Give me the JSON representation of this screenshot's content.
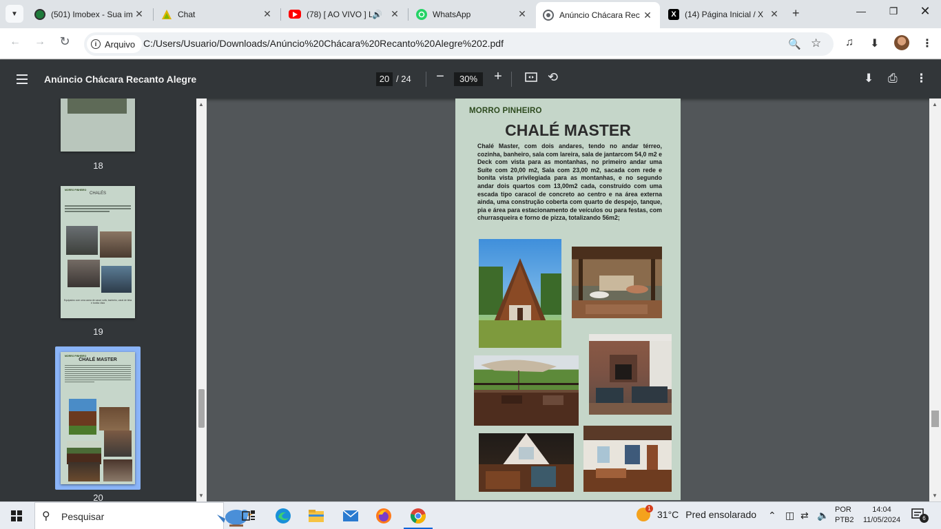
{
  "tabs": [
    {
      "title": "(501) Imobex - Sua im",
      "icon": "imobex-icon"
    },
    {
      "title": "Chat",
      "icon": "chat-icon"
    },
    {
      "title": "(78) [ AO VIVO ] L",
      "icon": "youtube-icon"
    },
    {
      "title": "WhatsApp",
      "icon": "whatsapp-icon"
    },
    {
      "title": "Anúncio Chácara Rec",
      "icon": "globe-icon"
    },
    {
      "title": "(14) Página Inicial / X",
      "icon": "x-icon"
    }
  ],
  "address": {
    "chip_label": "Arquivo",
    "url": "C:/Users/Usuario/Downloads/Anúncio%20Chácara%20Recanto%20Alegre%202.pdf"
  },
  "pdf": {
    "title": "Anúncio Chácara Recanto Alegre",
    "current_page": "20",
    "total_pages": "/ 24",
    "zoom": "30%"
  },
  "thumbnails": [
    {
      "number": "18"
    },
    {
      "number": "19",
      "kicker": "MORRO PINHEIRO",
      "title": "CHALÉS",
      "caption": "Equipados com uma cama de casal, sofá, banheiro, varal de tinta e bonita vista"
    },
    {
      "number": "20",
      "kicker": "MORRO PINHEIRO",
      "title": "CHALÉ MASTER"
    }
  ],
  "page": {
    "kicker": "MORRO PINHEIRO",
    "title": "CHALÉ MASTER",
    "body": "Chalé Master, com dois andares, tendo no andar térreo, cozinha, banheiro, sala com lareira, sala de jantarcom 54,0 m2 e Deck com vista para as montanhas, no primeiro andar uma Suíte com 20,00 m2, Sala com 23,00 m2, sacada com rede e bonita vista privilegiada para as montanhas, e no segundo andar dois quartos com 13,00m2 cada, construído com uma escada tipo caracol de concreto ao centro e na área externa ainda, uma construção coberta com quarto de despejo, tanque, pia e área para estacionamento de veículos ou para festas, com churrasqueira e forno de pizza, totalizando 56m2;"
  },
  "taskbar": {
    "search_placeholder": "Pesquisar",
    "weather_temp": "31°C",
    "weather_desc": "Pred ensolarado",
    "weather_badge": "1",
    "lang_line1": "POR",
    "lang_line2": "PTB2",
    "time": "14:04",
    "date": "11/05/2024",
    "notification_count": "6"
  }
}
